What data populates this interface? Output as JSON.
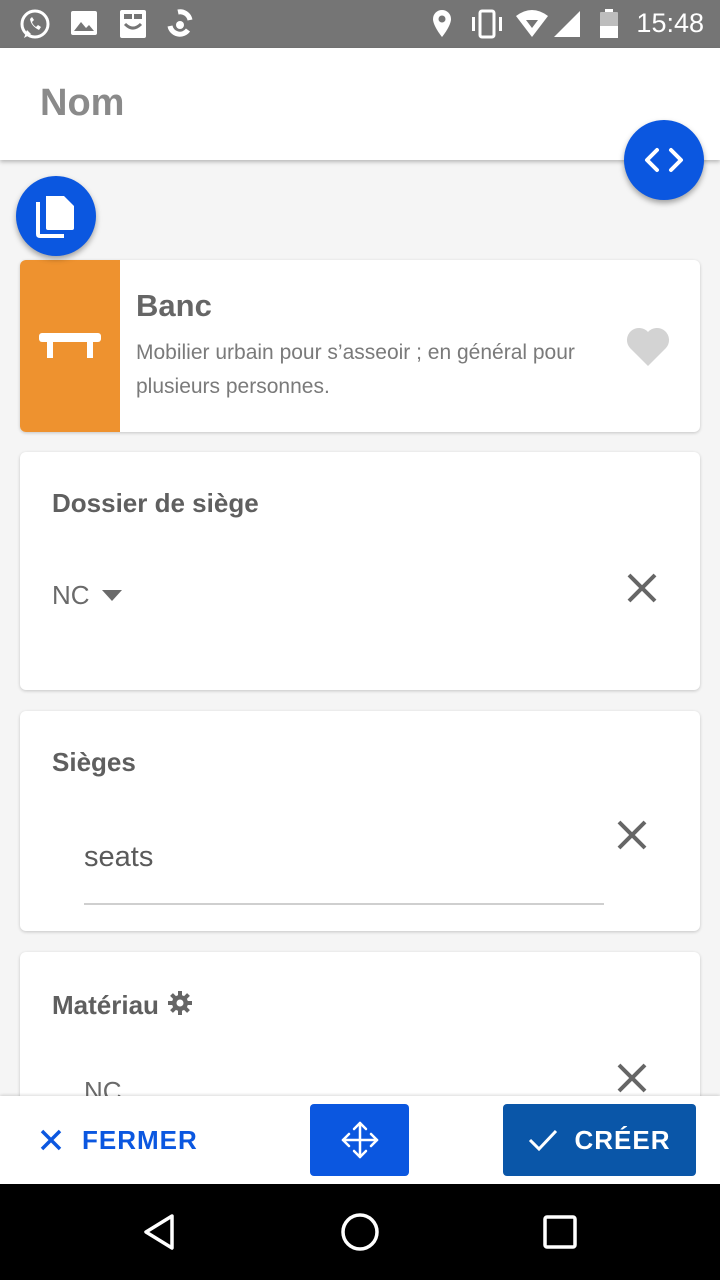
{
  "status_bar": {
    "time": "15:48",
    "icons": [
      "whatsapp-icon",
      "image-icon",
      "store-icon",
      "sync-icon",
      "location-icon",
      "vibrate-icon",
      "wifi-icon",
      "signal-icon",
      "battery-icon"
    ]
  },
  "header": {
    "name_placeholder": "Nom"
  },
  "fabs": {
    "code_icon": "code-icon",
    "copy_icon": "copy-icon"
  },
  "preset": {
    "title": "Banc",
    "description": "Mobilier urbain pour s’asseoir ; en général pour plusieurs personnes.",
    "icon": "bench-icon",
    "favorite_icon": "heart-icon",
    "accent_color": "#ee922f"
  },
  "fields": [
    {
      "label": "Dossier de siège",
      "value": "NC"
    },
    {
      "label": "Sièges",
      "placeholder": "seats"
    },
    {
      "label": "Matériau",
      "value": "NC"
    }
  ],
  "actions": {
    "close_label": "FERMER",
    "create_label": "CRÉER",
    "move_icon": "move-icon"
  },
  "colors": {
    "primary": "#0b57e0",
    "create": "#0a56a8"
  }
}
